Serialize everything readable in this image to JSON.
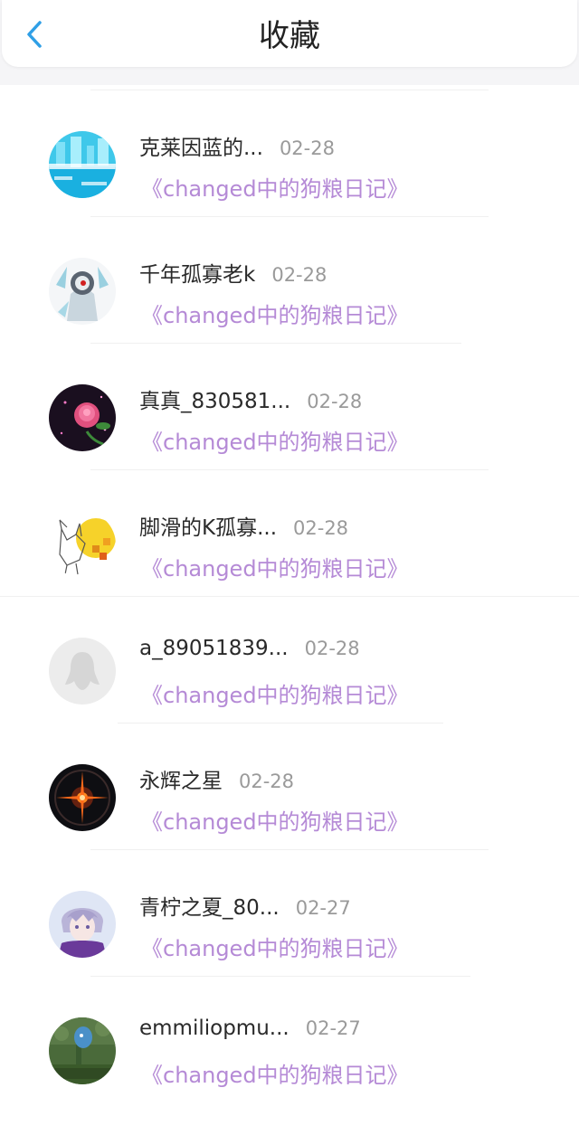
{
  "header": {
    "title": "收藏",
    "back_icon": "chevron-left-icon",
    "accent": "#2f9fe6"
  },
  "colors": {
    "book_link": "#b58ad6",
    "date": "#9a9a9a",
    "name": "#2a2a2a"
  },
  "items": [
    {
      "name": "克莱因蓝的...",
      "date": "02-28",
      "book": "《changed中的狗粮日记》",
      "avatar": "blue-pixel-avatar"
    },
    {
      "name": "千年孤寡老k",
      "date": "02-28",
      "book": "《changed中的狗粮日记》",
      "avatar": "masked-figure-avatar"
    },
    {
      "name": "真真_830581...",
      "date": "02-28",
      "book": "《changed中的狗粮日记》",
      "avatar": "rose-avatar"
    },
    {
      "name": "脚滑的K孤寡...",
      "date": "02-28",
      "book": "《changed中的狗粮日记》",
      "avatar": "sketch-fox-avatar"
    },
    {
      "name": "a_89051839...",
      "date": "02-28",
      "book": "《changed中的狗粮日记》",
      "avatar": "default-penguin-avatar"
    },
    {
      "name": "永辉之星",
      "date": "02-28",
      "book": "《changed中的狗粮日记》",
      "avatar": "dark-star-avatar"
    },
    {
      "name": "青柠之夏_80...",
      "date": "02-27",
      "book": "《changed中的狗粮日记》",
      "avatar": "anime-boy-avatar"
    },
    {
      "name": "emmiliopmu...",
      "date": "02-27",
      "book": "《changed中的狗粮日记》",
      "avatar": "green-figure-avatar"
    }
  ]
}
